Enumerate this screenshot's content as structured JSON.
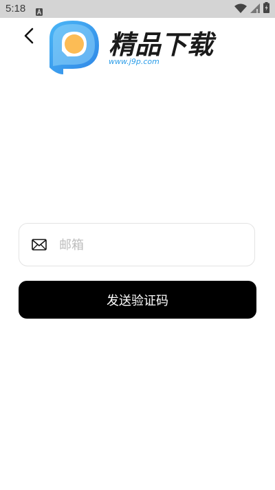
{
  "status_bar": {
    "time": "5:18",
    "notification_icon": "notification-a-icon",
    "icons": [
      "wifi-icon",
      "cell-signal-icon",
      "battery-icon"
    ]
  },
  "header": {
    "back_icon": "chevron-left-icon",
    "logo": {
      "brand_text": "精品下载",
      "url_text": "www.j9p.com"
    }
  },
  "form": {
    "email": {
      "icon": "mail-icon",
      "placeholder": "邮箱",
      "value": ""
    },
    "send_button_label": "发送验证码"
  },
  "colors": {
    "status_bar_bg": "#d4d4d4",
    "button_bg": "#000000",
    "button_text": "#ffffff",
    "logo_blue": "#3ea7f2",
    "logo_orange": "#fcbc55",
    "url_blue": "#2a9ce8"
  }
}
